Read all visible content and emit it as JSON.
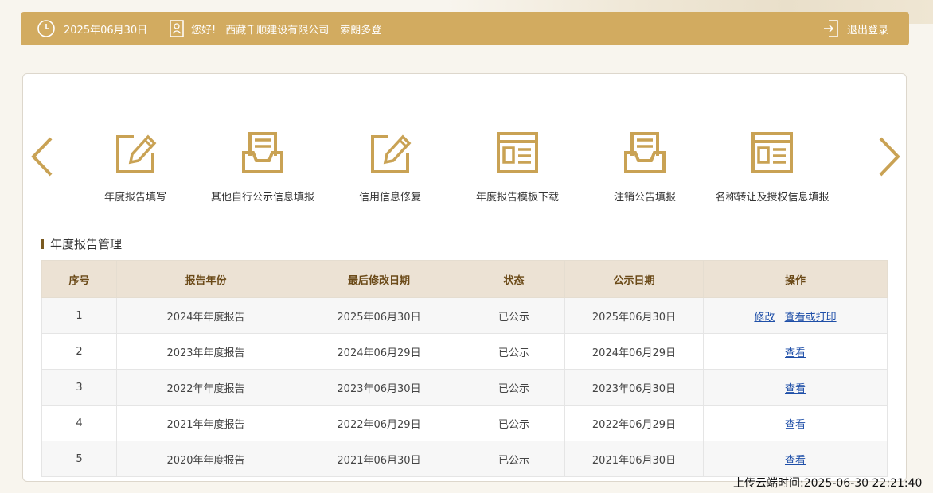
{
  "header": {
    "date": "2025年06月30日",
    "greeting": "您好!",
    "company": "西藏千顺建设有限公司",
    "user": "索朗多登",
    "logout_label": "退出登录"
  },
  "nav": {
    "tiles": [
      {
        "label": "年度报告填写",
        "icon": "edit-form-icon"
      },
      {
        "label": "其他自行公示信息填报",
        "icon": "inbox-document-icon"
      },
      {
        "label": "信用信息修复",
        "icon": "edit-form-icon"
      },
      {
        "label": "年度报告模板下载",
        "icon": "template-window-icon"
      },
      {
        "label": "注销公告填报",
        "icon": "inbox-document-icon"
      },
      {
        "label": "名称转让及授权信息填报",
        "icon": "template-window-icon"
      }
    ]
  },
  "section": {
    "title": "年度报告管理"
  },
  "table": {
    "headers": [
      "序号",
      "报告年份",
      "最后修改日期",
      "状态",
      "公示日期",
      "操作"
    ],
    "rows": [
      {
        "no": "1",
        "year": "2024年年度报告",
        "modified": "2025年06月30日",
        "status": "已公示",
        "published": "2025年06月30日",
        "actions": [
          "修改",
          "查看或打印"
        ]
      },
      {
        "no": "2",
        "year": "2023年年度报告",
        "modified": "2024年06月29日",
        "status": "已公示",
        "published": "2024年06月29日",
        "actions": [
          "查看"
        ]
      },
      {
        "no": "3",
        "year": "2022年年度报告",
        "modified": "2023年06月30日",
        "status": "已公示",
        "published": "2023年06月30日",
        "actions": [
          "查看"
        ]
      },
      {
        "no": "4",
        "year": "2021年年度报告",
        "modified": "2022年06月29日",
        "status": "已公示",
        "published": "2022年06月29日",
        "actions": [
          "查看"
        ]
      },
      {
        "no": "5",
        "year": "2020年年度报告",
        "modified": "2021年06月30日",
        "status": "已公示",
        "published": "2021年06月30日",
        "actions": [
          "查看"
        ]
      }
    ]
  },
  "footer": {
    "upload_time": "上传云端时间:2025-06-30 22:21:40"
  },
  "colors": {
    "accent": "#d2ab60",
    "header_row": "#ece2d4",
    "link": "#1f4fa8"
  }
}
